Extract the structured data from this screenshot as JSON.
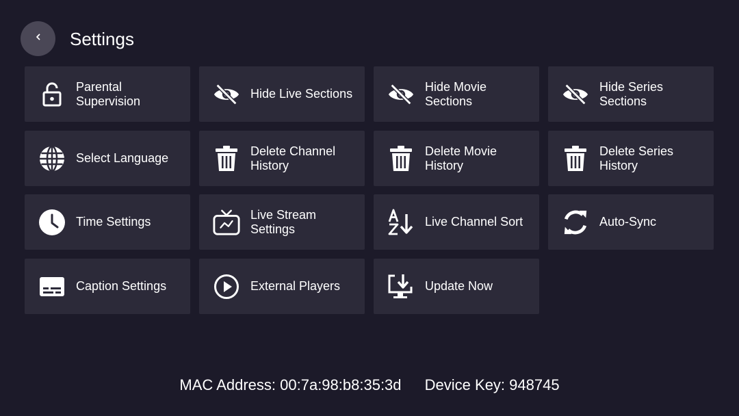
{
  "header": {
    "title": "Settings"
  },
  "tiles": [
    {
      "label": "Parental\nSupervision",
      "icon": "lock-icon"
    },
    {
      "label": "Hide Live Sections",
      "icon": "eye-off-icon"
    },
    {
      "label": "Hide Movie\nSections",
      "icon": "eye-off-icon"
    },
    {
      "label": "Hide Series\nSections",
      "icon": "eye-off-icon"
    },
    {
      "label": "Select Language",
      "icon": "globe-icon"
    },
    {
      "label": "Delete Channel\nHistory",
      "icon": "trash-icon"
    },
    {
      "label": "Delete Movie\nHistory",
      "icon": "trash-icon"
    },
    {
      "label": "Delete Series\nHistory",
      "icon": "trash-icon"
    },
    {
      "label": "Time Settings",
      "icon": "clock-icon"
    },
    {
      "label": "Live Stream\nSettings",
      "icon": "tv-icon"
    },
    {
      "label": "Live Channel Sort",
      "icon": "sort-az-icon"
    },
    {
      "label": "Auto-Sync",
      "icon": "sync-icon"
    },
    {
      "label": "Caption Settings",
      "icon": "caption-icon"
    },
    {
      "label": "External Players",
      "icon": "play-circle-icon"
    },
    {
      "label": "Update Now",
      "icon": "download-screen-icon"
    }
  ],
  "footer": {
    "mac_address": "MAC Address: 00:7a:98:b8:35:3d",
    "device_key": "Device Key: 948745"
  },
  "colors": {
    "background": "#1c1a29",
    "tile": "#2c2a39",
    "back_button": "#4a4756",
    "text": "#ffffff"
  }
}
